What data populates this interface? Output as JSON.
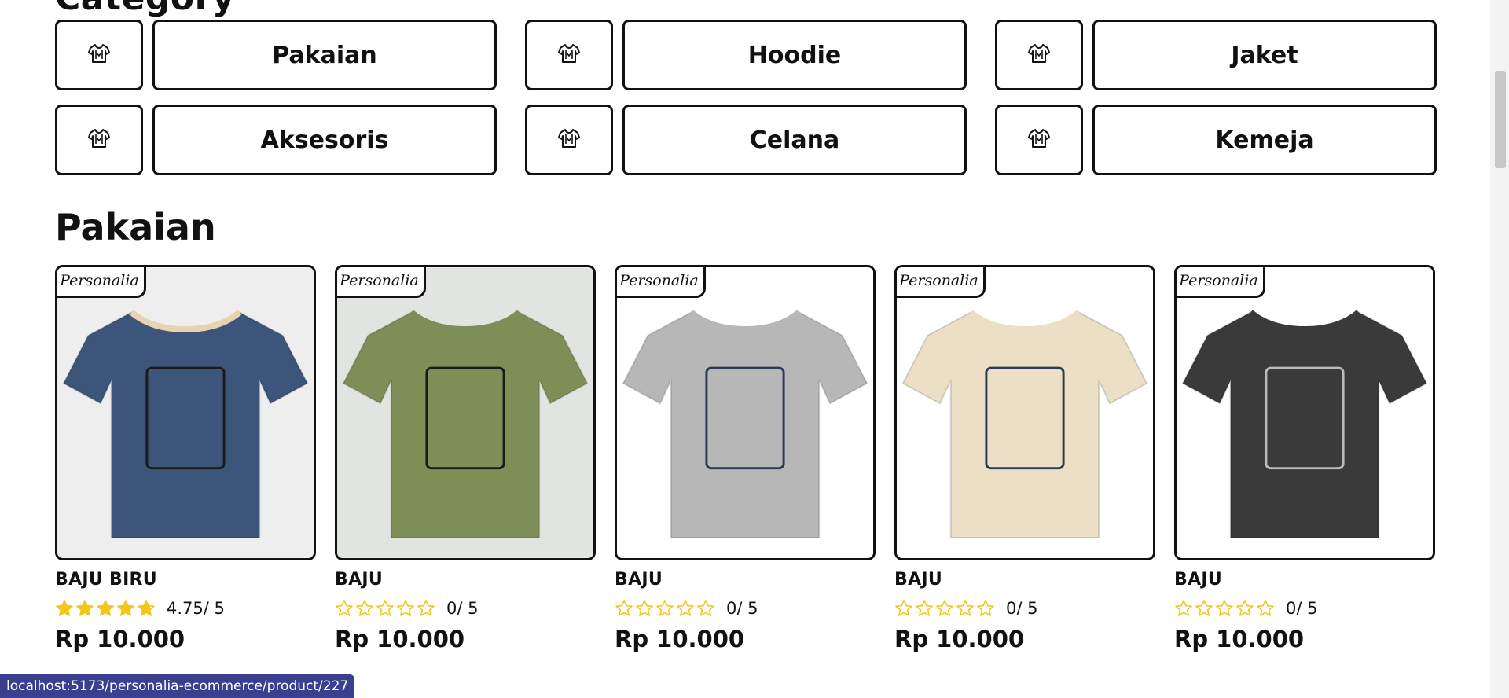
{
  "category": {
    "heading": "Category",
    "items": [
      {
        "label": "Pakaian",
        "icon": "shirt-icon"
      },
      {
        "label": "Hoodie",
        "icon": "shirt-icon"
      },
      {
        "label": "Jaket",
        "icon": "shirt-icon"
      },
      {
        "label": "Aksesoris",
        "icon": "shirt-icon"
      },
      {
        "label": "Celana",
        "icon": "shirt-icon"
      },
      {
        "label": "Kemeja",
        "icon": "shirt-icon"
      }
    ]
  },
  "section": {
    "title": "Pakaian"
  },
  "products": [
    {
      "brand": "Personalia",
      "name": "BAJU BIRU",
      "rating": 4.75,
      "rating_text": "4.75/ 5",
      "price": "Rp 10.000",
      "shirt_color": "#3d557a",
      "bg": "#eeeeee"
    },
    {
      "brand": "Personalia",
      "name": "BAJU",
      "rating": 0,
      "rating_text": "0/ 5",
      "price": "Rp 10.000",
      "shirt_color": "#7f8e56",
      "bg": "#e2e4e2"
    },
    {
      "brand": "Personalia",
      "name": "BAJU",
      "rating": 0,
      "rating_text": "0/ 5",
      "price": "Rp 10.000",
      "shirt_color": "#b7b7b7",
      "bg": "#ffffff"
    },
    {
      "brand": "Personalia",
      "name": "BAJU",
      "rating": 0,
      "rating_text": "0/ 5",
      "price": "Rp 10.000",
      "shirt_color": "#ebe0c6",
      "bg": "#ffffff"
    },
    {
      "brand": "Personalia",
      "name": "BAJU",
      "rating": 0,
      "rating_text": "0/ 5",
      "price": "Rp 10.000",
      "shirt_color": "#3a3a3a",
      "bg": "#ffffff"
    }
  ],
  "status_bar": {
    "url": "localhost:5173/personalia-ecommerce/product/227"
  },
  "colors": {
    "star": "#f5c518",
    "accent": "#3b3f8f"
  }
}
